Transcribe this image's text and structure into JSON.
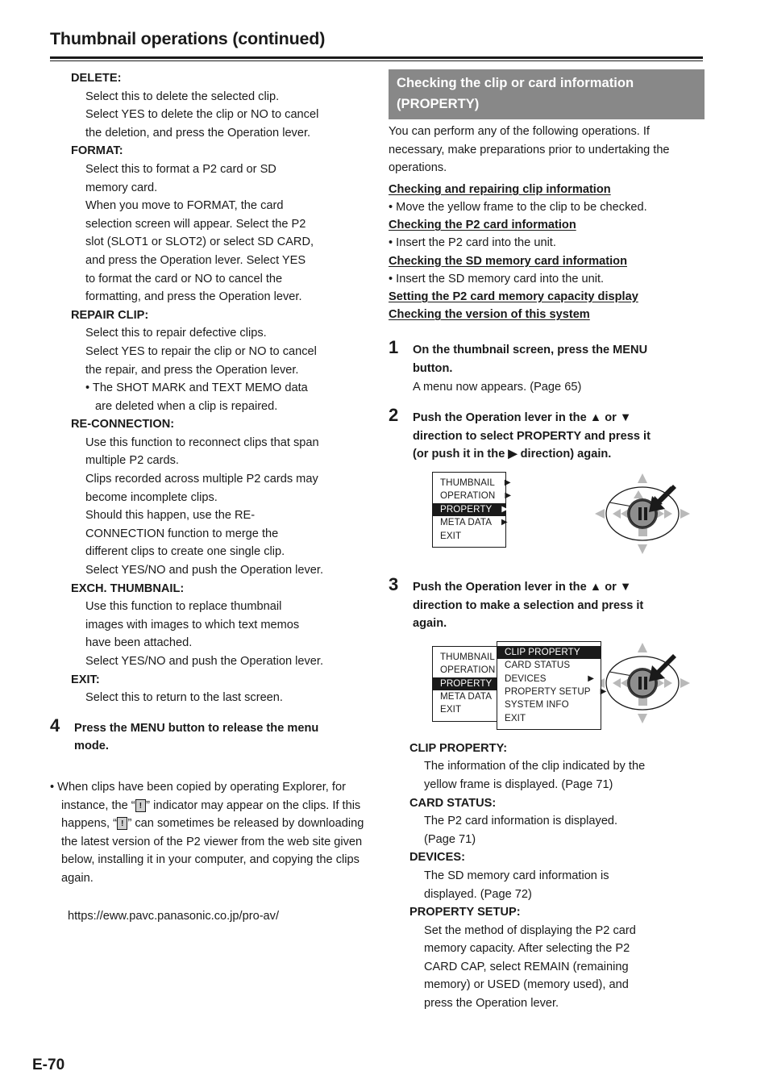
{
  "page": {
    "title": "Thumbnail operations (continued)",
    "footer": "E-70"
  },
  "left_column": {
    "entries": [
      {
        "term": "DELETE:",
        "lines": [
          "Select this to delete the selected clip.",
          "Select YES to delete the clip or NO to cancel",
          "the deletion, and press the Operation lever."
        ]
      },
      {
        "term": "FORMAT:",
        "lines": [
          "Select this to format a P2 card or SD",
          "memory card.",
          "When you move to FORMAT, the card",
          "selection screen will appear. Select the P2",
          "slot (SLOT1 or SLOT2) or select SD CARD,",
          "and press the Operation lever. Select YES",
          "to format the card or NO to cancel the",
          "formatting, and press the Operation lever."
        ]
      },
      {
        "term": "REPAIR CLIP:",
        "lines": [
          "Select this to repair defective clips.",
          "Select YES to repair the clip or NO to cancel",
          "the repair, and press the Operation lever."
        ],
        "bullets": [
          "• The SHOT MARK and TEXT MEMO data",
          "are deleted when a clip is repaired."
        ]
      },
      {
        "term": "RE-CONNECTION:",
        "lines": [
          "Use this function to reconnect clips that span",
          "multiple P2 cards.",
          "Clips recorded across multiple P2 cards may",
          "become incomplete clips.",
          "Should this happen, use the RE-",
          "CONNECTION function to merge the",
          "different clips to create one single clip.",
          "Select YES/NO and push the Operation lever."
        ]
      },
      {
        "term": "EXCH. THUMBNAIL:",
        "lines": [
          "Use this function to replace thumbnail",
          "images with images to which text memos",
          "have been attached.",
          "Select YES/NO and push the Operation lever."
        ]
      },
      {
        "term": "EXIT:",
        "lines": [
          "Select this to return to the last screen."
        ]
      }
    ],
    "step4": {
      "number": "4",
      "title_line1": "Press the MENU button to release the menu",
      "title_line2": "mode."
    },
    "note": {
      "part1": "• When clips have been copied by operating Explorer, for instance, the “",
      "indicator": "!",
      "part2": "” indicator may appear on the clips. If this happens, “",
      "indicator2": "!",
      "part3": "” can sometimes be released by downloading the latest version of the P2 viewer from the web site given below, installing it in your computer, and copying the clips again.",
      "url": "https://eww.pavc.panasonic.co.jp/pro-av/"
    }
  },
  "right_column": {
    "banner": {
      "line1": "Checking the clip or card information",
      "line2": "(PROPERTY)"
    },
    "intro": "You can perform any of the following operations. If necessary, make preparations prior to undertaking the operations.",
    "prep_sections": [
      {
        "heading": "Checking and repairing clip information",
        "bullet": "• Move the yellow frame to the clip to be checked."
      },
      {
        "heading": "Checking the P2 card information",
        "bullet": "• Insert the P2 card into the unit."
      },
      {
        "heading": "Checking the SD memory card information",
        "bullet": "• Insert the SD memory card into the unit."
      },
      {
        "heading": "Setting the P2 card memory capacity display",
        "bullet": ""
      },
      {
        "heading": "Checking the version of this system",
        "bullet": ""
      }
    ],
    "step1": {
      "number": "1",
      "title_line1": "On the thumbnail screen, press the MENU",
      "title_line2": "button.",
      "sub": "A menu now appears. (Page 65)"
    },
    "step2": {
      "number": "2",
      "title_line1": "Push the Operation lever in the ▲ or ▼",
      "title_line2": "direction to select PROPERTY and press it",
      "title_line3": "(or push it in the ▶ direction) again."
    },
    "menu1": {
      "items": [
        {
          "label": "THUMBNAIL",
          "arrow": "▶",
          "selected": false
        },
        {
          "label": "OPERATION",
          "arrow": "▶",
          "selected": false
        },
        {
          "label": "PROPERTY",
          "arrow": "▶",
          "selected": true
        },
        {
          "label": "META DATA",
          "arrow": "▶",
          "selected": false
        },
        {
          "label": "EXIT",
          "arrow": "",
          "selected": false
        }
      ]
    },
    "step3": {
      "number": "3",
      "title_line1": "Push the Operation lever in the ▲ or ▼",
      "title_line2": "direction to make a selection and press it",
      "title_line3": "again."
    },
    "menu2_outer": {
      "items": [
        {
          "label": "THUMBNAIL",
          "arrow": "",
          "selected": false
        },
        {
          "label": "OPERATION",
          "arrow": "",
          "selected": false
        },
        {
          "label": "PROPERTY",
          "arrow": "",
          "selected": true
        },
        {
          "label": "META DATA",
          "arrow": "",
          "selected": false
        },
        {
          "label": "EXIT",
          "arrow": "",
          "selected": false
        }
      ]
    },
    "menu2_inner": {
      "items": [
        {
          "label": "CLIP PROPERTY",
          "arrow": "",
          "selected": true
        },
        {
          "label": "CARD STATUS",
          "arrow": "",
          "selected": false
        },
        {
          "label": "DEVICES",
          "arrow": "▶",
          "selected": false
        },
        {
          "label": "PROPERTY SETUP",
          "arrow": "▶",
          "selected": false
        },
        {
          "label": "SYSTEM INFO",
          "arrow": "",
          "selected": false
        },
        {
          "label": "EXIT",
          "arrow": "",
          "selected": false
        }
      ]
    },
    "entries": [
      {
        "term": "CLIP PROPERTY:",
        "lines": [
          "The information of the clip indicated by the",
          "yellow frame is displayed. (Page 71)"
        ]
      },
      {
        "term": "CARD STATUS:",
        "lines": [
          "The P2 card information is displayed.",
          "(Page 71)"
        ]
      },
      {
        "term": "DEVICES:",
        "lines": [
          "The SD memory card information is",
          "displayed. (Page 72)"
        ]
      },
      {
        "term": "PROPERTY SETUP:",
        "lines": [
          "Set the method of displaying the P2 card",
          "memory capacity. After selecting the P2",
          "CARD CAP, select REMAIN (remaining",
          "memory) or USED (memory used), and",
          "press the Operation lever."
        ]
      }
    ]
  },
  "colors": {
    "banner_bg": "#888888",
    "text": "#1a1a1a",
    "menu_selected_bg": "#1a1a1a",
    "indicator_bg": "#cfcfcf"
  }
}
